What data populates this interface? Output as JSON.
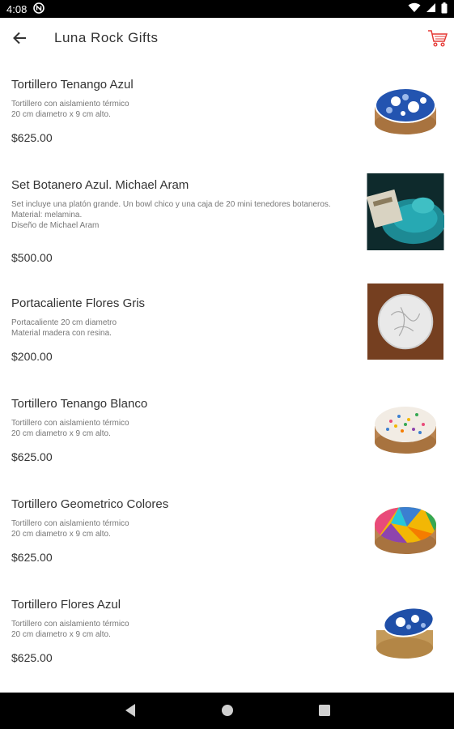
{
  "status": {
    "time": "4:08"
  },
  "header": {
    "title": "Luna Rock Gifts"
  },
  "colors": {
    "cart": "#e53935",
    "tenango_blue": "#1f4fa8",
    "wood": "#6b3a1e"
  },
  "products": [
    {
      "name": "Tortillero Tenango Azul",
      "description": "Tortillero con aislamiento térmico\n20 cm diametro x 9 cm alto.",
      "price": "$625.00",
      "image": "blue-tenango-tortilla-warmer"
    },
    {
      "name": "Set Botanero Azul. Michael Aram",
      "description": "Set incluye una platón grande. Un bowl chico y una caja de 20 mini tenedores botaneros.\nMaterial: melamina.\nDiseño de Michael Aram",
      "price": "$500.00",
      "image": "blue-serving-set"
    },
    {
      "name": "Portacaliente Flores Gris",
      "description": "Portacaliente 20 cm diametro\nMaterial madera con resina.",
      "price": "$200.00",
      "image": "grey-flower-trivet"
    },
    {
      "name": "Tortillero Tenango Blanco",
      "description": "Tortillero con aislamiento térmico\n20 cm diametro x 9 cm alto.",
      "price": "$625.00",
      "image": "white-tenango-tortilla-warmer"
    },
    {
      "name": "Tortillero Geometrico Colores",
      "description": "Tortillero con aislamiento térmico\n20 cm diametro x 9 cm alto.",
      "price": "$625.00",
      "image": "geometric-tortilla-warmer"
    },
    {
      "name": "Tortillero Flores Azul",
      "description": "Tortillero con aislamiento térmico\n20 cm diametro x 9 cm alto.",
      "price": "$625.00",
      "image": "blue-flower-tortilla-warmer"
    }
  ]
}
